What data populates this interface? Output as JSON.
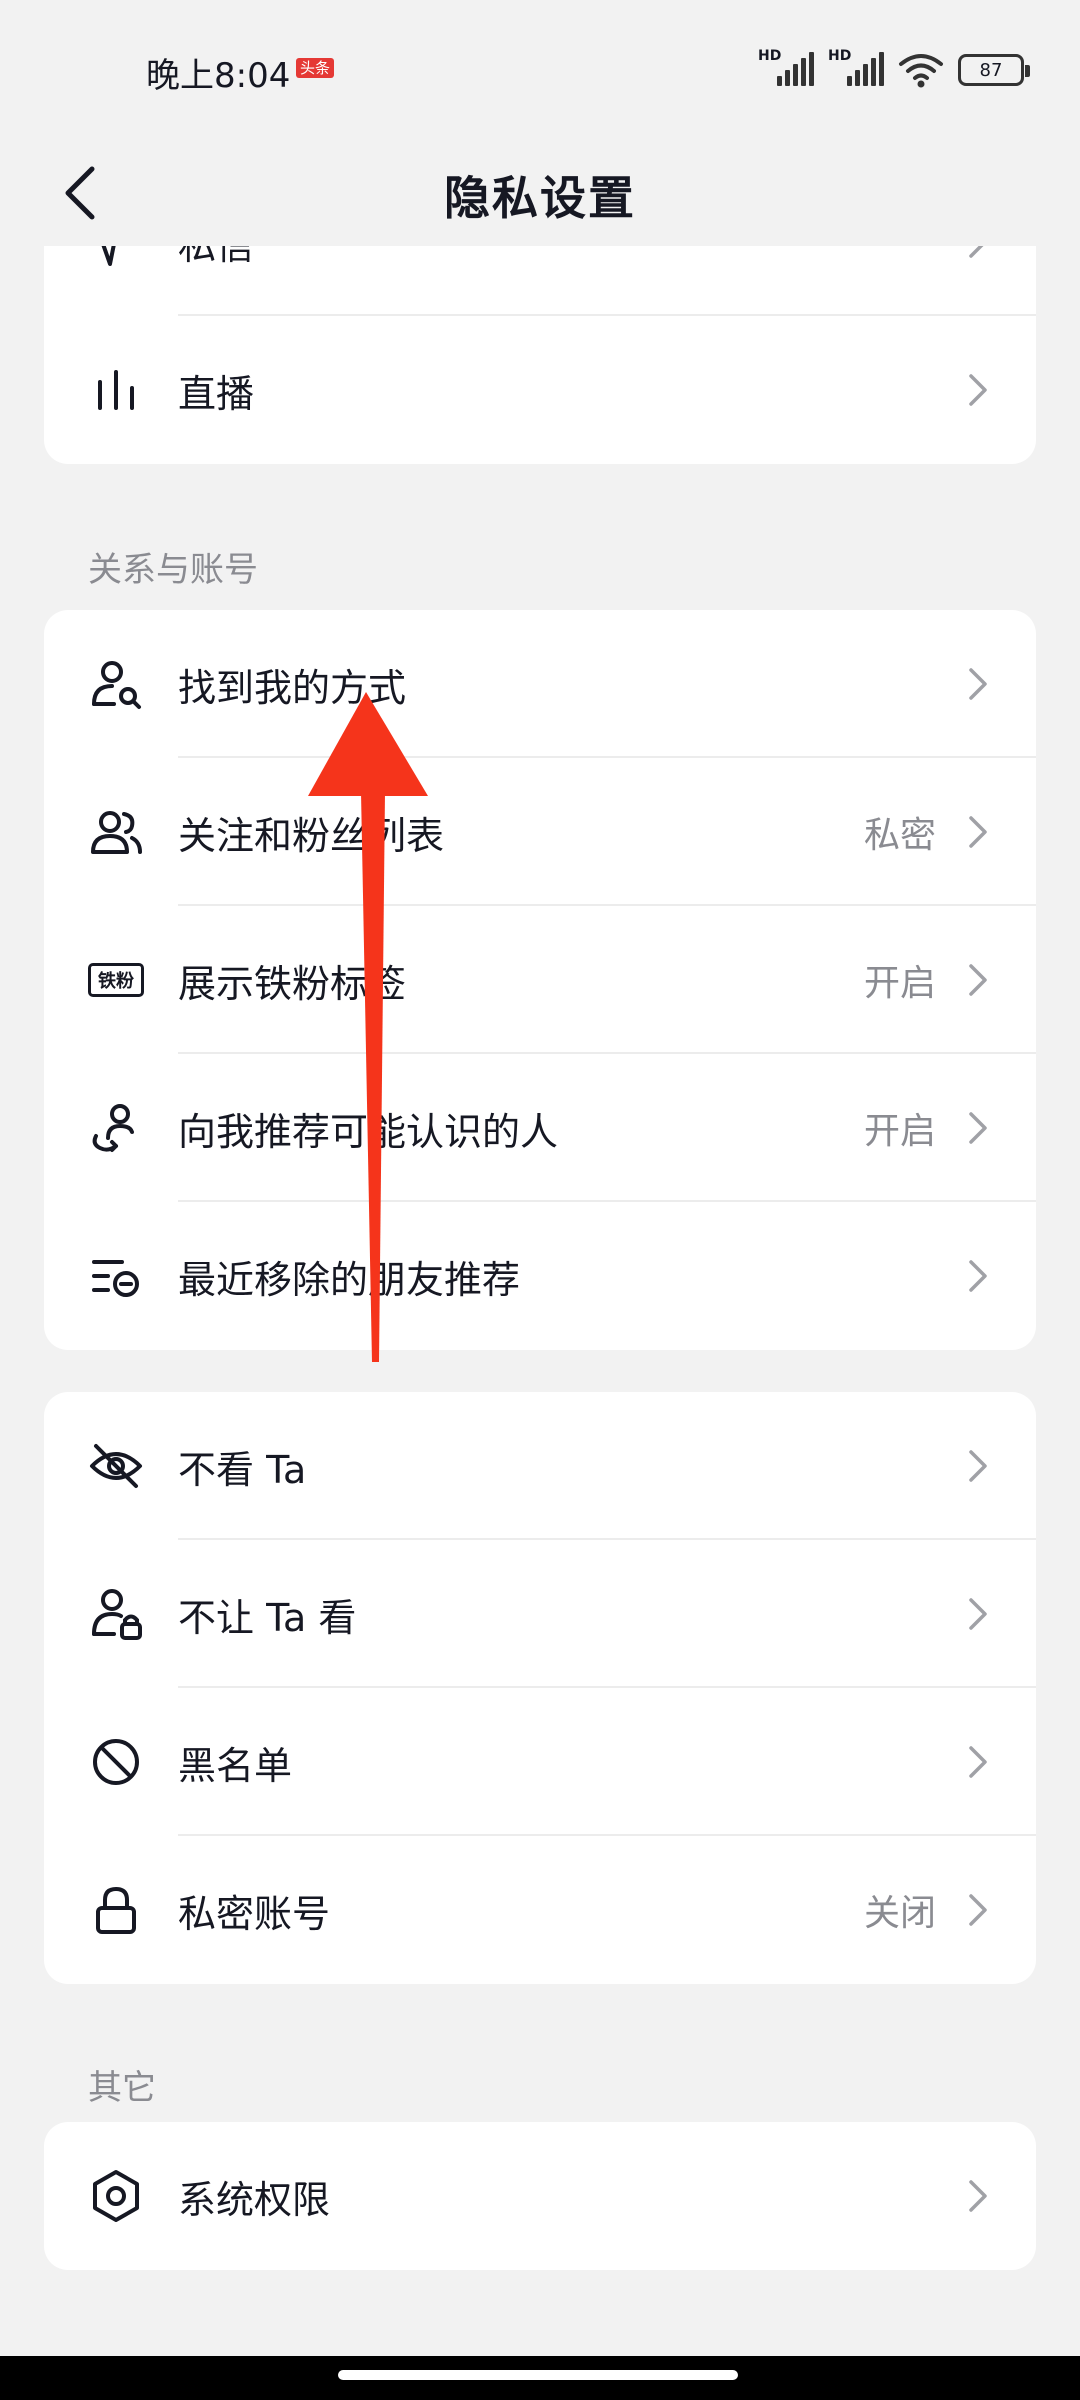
{
  "status_bar": {
    "time": "晚上8:04",
    "badge": "头条",
    "signal1_label": "HD",
    "signal2_label": "HD",
    "battery": "87"
  },
  "nav": {
    "title": "隐私设置"
  },
  "card_top": {
    "items": [
      {
        "label": "私信",
        "icon": "message-send-icon"
      },
      {
        "label": "直播",
        "icon": "live-bars-icon"
      }
    ]
  },
  "section_relations": {
    "label": "关系与账号",
    "items": [
      {
        "label": "找到我的方式",
        "value": "",
        "icon": "person-search-icon"
      },
      {
        "label": "关注和粉丝列表",
        "value": "私密",
        "icon": "people-icon"
      },
      {
        "label": "展示铁粉标签",
        "value": "开启",
        "icon": "iron-fan-badge-icon"
      },
      {
        "label": "向我推荐可能认识的人",
        "value": "开启",
        "icon": "person-recommend-icon"
      },
      {
        "label": "最近移除的朋友推荐",
        "value": "",
        "icon": "list-removed-icon"
      }
    ]
  },
  "badge_icon_text": "铁粉",
  "section_block": {
    "items": [
      {
        "label": "不看 Ta",
        "value": "",
        "icon": "eye-off-icon"
      },
      {
        "label": "不让 Ta 看",
        "value": "",
        "icon": "person-lock-icon"
      },
      {
        "label": "黑名单",
        "value": "",
        "icon": "block-icon"
      },
      {
        "label": "私密账号",
        "value": "关闭",
        "icon": "lock-icon"
      }
    ]
  },
  "section_other": {
    "label": "其它",
    "items": [
      {
        "label": "系统权限",
        "value": "",
        "icon": "hexagon-settings-icon"
      }
    ]
  },
  "colors": {
    "background": "#f2f2f2",
    "card": "#ffffff",
    "text": "#161823",
    "secondary": "#8a8b91",
    "annotation_arrow": "#f5341b"
  }
}
